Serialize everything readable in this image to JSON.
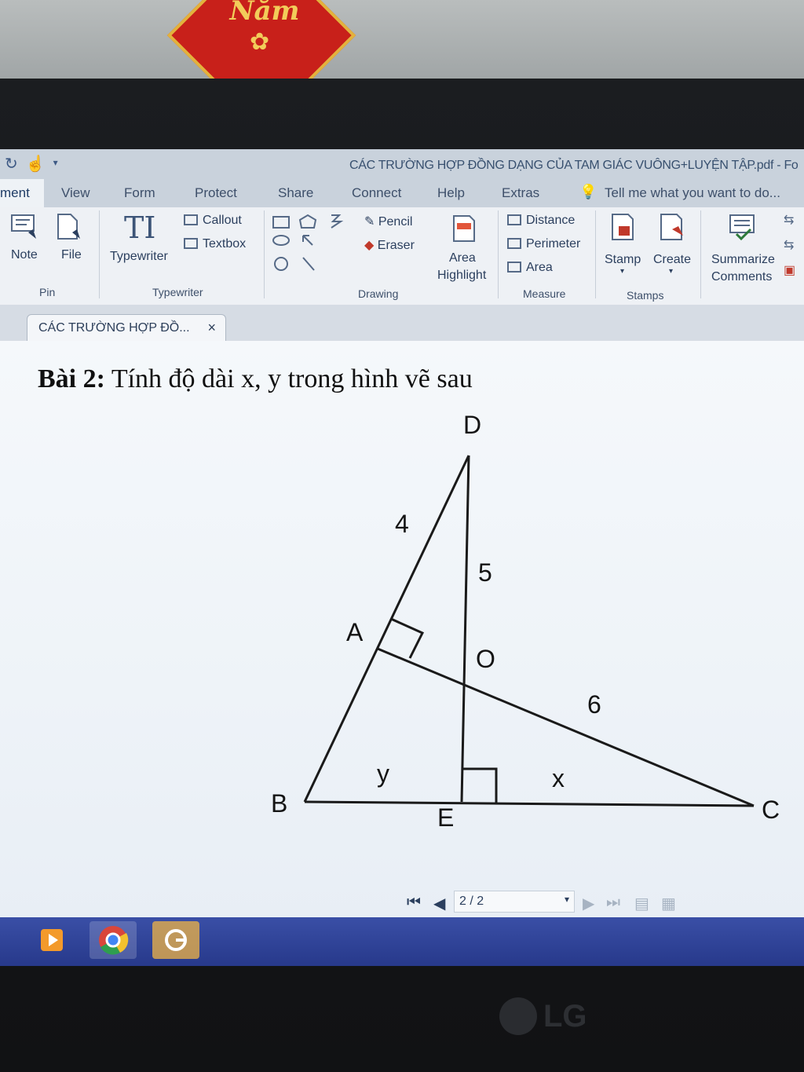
{
  "decoration": {
    "text": "Năm"
  },
  "window": {
    "title": "CÁC TRƯỜNG HỢP ĐỒNG DẠNG CỦA TAM GIÁC VUÔNG+LUYỆN TẬP.pdf - Fo"
  },
  "menu": {
    "tabs": [
      "ment",
      "View",
      "Form",
      "Protect",
      "Share",
      "Connect",
      "Help",
      "Extras"
    ],
    "tell_me": "Tell me what you want to do..."
  },
  "ribbon": {
    "pin": {
      "note": "Note",
      "file": "File",
      "label": "Pin"
    },
    "typewriter": {
      "typewriter": "Typewriter",
      "callout": "Callout",
      "textbox": "Textbox",
      "label": "Typewriter"
    },
    "drawing": {
      "pencil": "Pencil",
      "eraser": "Eraser",
      "area_highlight_1": "Area",
      "area_highlight_2": "Highlight",
      "label": "Drawing"
    },
    "measure": {
      "distance": "Distance",
      "perimeter": "Perimeter",
      "area": "Area",
      "label": "Measure"
    },
    "stamps": {
      "stamp": "Stamp",
      "create": "Create",
      "label": "Stamps"
    },
    "comments": {
      "summarize_1": "Summarize",
      "summarize_2": "Comments"
    }
  },
  "document_tab": {
    "label": "CÁC TRƯỜNG HỢP ĐỒ...",
    "close": "×"
  },
  "content": {
    "heading_bold": "Bài 2:",
    "heading_text": " Tính độ dài x, y trong hình vẽ sau",
    "figure_labels": {
      "D": "D",
      "A": "A",
      "O": "O",
      "B": "B",
      "E": "E",
      "C": "C",
      "len_DA": "4",
      "len_DO": "5",
      "len_OC": "6",
      "len_BE": "y",
      "len_EC": "x"
    }
  },
  "navigation": {
    "page": "2 / 2"
  }
}
